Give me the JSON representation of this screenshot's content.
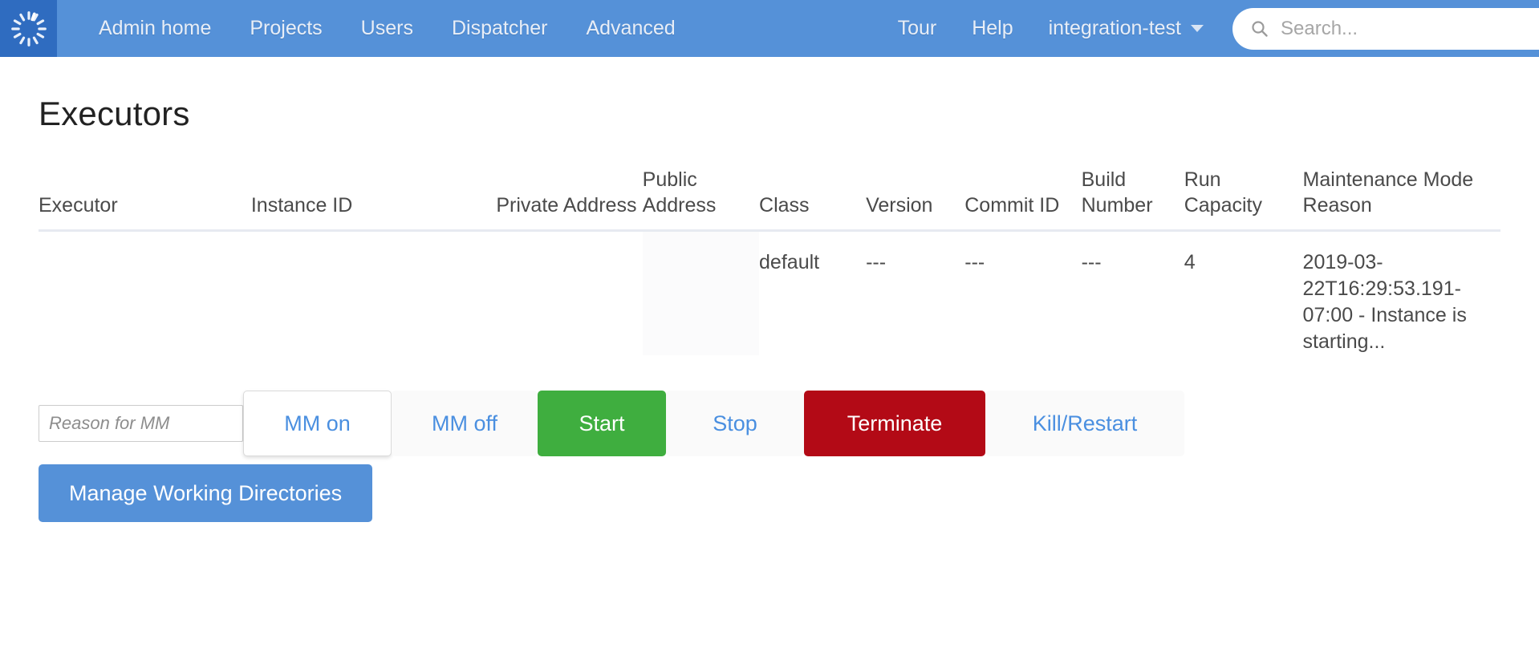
{
  "navbar": {
    "logo_name": "circleci-logo",
    "links": [
      {
        "label": "Admin home",
        "name": "nav-admin-home"
      },
      {
        "label": "Projects",
        "name": "nav-projects"
      },
      {
        "label": "Users",
        "name": "nav-users"
      },
      {
        "label": "Dispatcher",
        "name": "nav-dispatcher"
      },
      {
        "label": "Advanced",
        "name": "nav-advanced"
      }
    ],
    "right_links": [
      {
        "label": "Tour",
        "name": "nav-tour"
      },
      {
        "label": "Help",
        "name": "nav-help"
      }
    ],
    "org": "integration-test",
    "search_placeholder": "Search...",
    "search_value": "",
    "colors": {
      "nav_bg": "#5591d8",
      "logo_bg": "#2f6cc0",
      "nav_text": "#e8eef7"
    }
  },
  "page": {
    "title": "Executors"
  },
  "table": {
    "columns": [
      "Executor",
      "Instance ID",
      "Private Address",
      "Public Address",
      "Class",
      "Version",
      "Commit ID",
      "Build Number",
      "Run Capacity",
      "Maintenance Mode Reason"
    ],
    "rows": [
      {
        "executor": "",
        "instance_id": "",
        "private_address": "",
        "public_address": "",
        "class": "default",
        "version": "---",
        "commit_id": "---",
        "build_number": "---",
        "run_capacity": "4",
        "maintenance_mode_reason": "2019-03-22T16:29:53.191-07:00 - Instance is starting..."
      }
    ]
  },
  "actions": {
    "reason_placeholder": "Reason for MM",
    "reason_value": "",
    "buttons": [
      {
        "label": "MM on",
        "name": "mm-on-button"
      },
      {
        "label": "MM off",
        "name": "mm-off-button"
      },
      {
        "label": "Start",
        "name": "start-button"
      },
      {
        "label": "Stop",
        "name": "stop-button"
      },
      {
        "label": "Terminate",
        "name": "terminate-button"
      },
      {
        "label": "Kill/Restart",
        "name": "kill-restart-button"
      }
    ],
    "manage_label": "Manage Working Directories",
    "colors": {
      "start_bg": "#3fae3f",
      "terminate_bg": "#b30a16",
      "link_blue": "#4a8fe0",
      "manage_bg": "#5591d8"
    }
  }
}
